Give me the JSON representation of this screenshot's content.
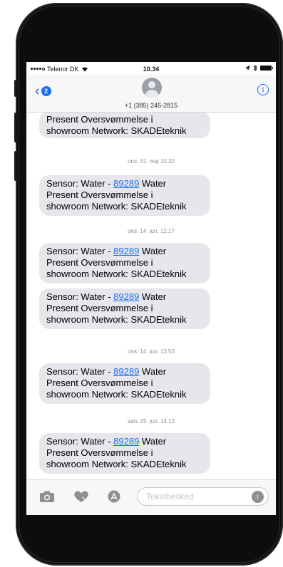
{
  "status_bar": {
    "carrier": "Telenor DK",
    "time": "10.34",
    "right_icons": [
      "location-arrow-icon",
      "bluetooth-icon",
      "battery-icon"
    ]
  },
  "header": {
    "back_badge": "2",
    "contact": "+1 (385) 245-2815"
  },
  "messages": [
    {
      "type": "bubble",
      "lines": [
        "Present Oversvømmelse i",
        "showroom Network: SKADEteknik"
      ],
      "partial": true
    },
    {
      "type": "timestamp",
      "text": "ons. 31. maj 10.32"
    },
    {
      "type": "bubble",
      "prefix": "Sensor: Water - ",
      "number": "89289",
      "suffix": " Water",
      "lines": [
        "Present Oversvømmelse i",
        "showroom Network: SKADEteknik"
      ]
    },
    {
      "type": "timestamp",
      "text": "ons. 14. jun. 12.17"
    },
    {
      "type": "bubble",
      "prefix": "Sensor: Water - ",
      "number": "89289",
      "suffix": " Water",
      "lines": [
        "Present Oversvømmelse i",
        "showroom Network: SKADEteknik"
      ]
    },
    {
      "type": "bubble",
      "prefix": "Sensor: Water - ",
      "number": "89289",
      "suffix": " Water",
      "lines": [
        "Present Oversvømmelse i",
        "showroom Network: SKADEteknik"
      ]
    },
    {
      "type": "timestamp",
      "text": "ons. 14. jun. 13.53"
    },
    {
      "type": "bubble",
      "prefix": "Sensor: Water - ",
      "number": "89289",
      "suffix": " Water",
      "lines": [
        "Present Oversvømmelse i",
        "showroom Network: SKADEteknik"
      ]
    },
    {
      "type": "timestamp",
      "text": "søn. 25. jun. 14.12"
    },
    {
      "type": "bubble",
      "prefix": "Sensor: Water - ",
      "number": "89289",
      "suffix": " Water",
      "lines": [
        "Present Oversvømmelse i",
        "showroom Network: SKADEteknik"
      ]
    }
  ],
  "input_bar": {
    "placeholder": "Tekstbesked",
    "icons": [
      "camera-icon",
      "digital-touch-heart-icon",
      "app-store-icon"
    ]
  },
  "colors": {
    "accent": "#1b6ff5",
    "bubble": "#e6e6eb",
    "frame": "#0d0d0d"
  }
}
